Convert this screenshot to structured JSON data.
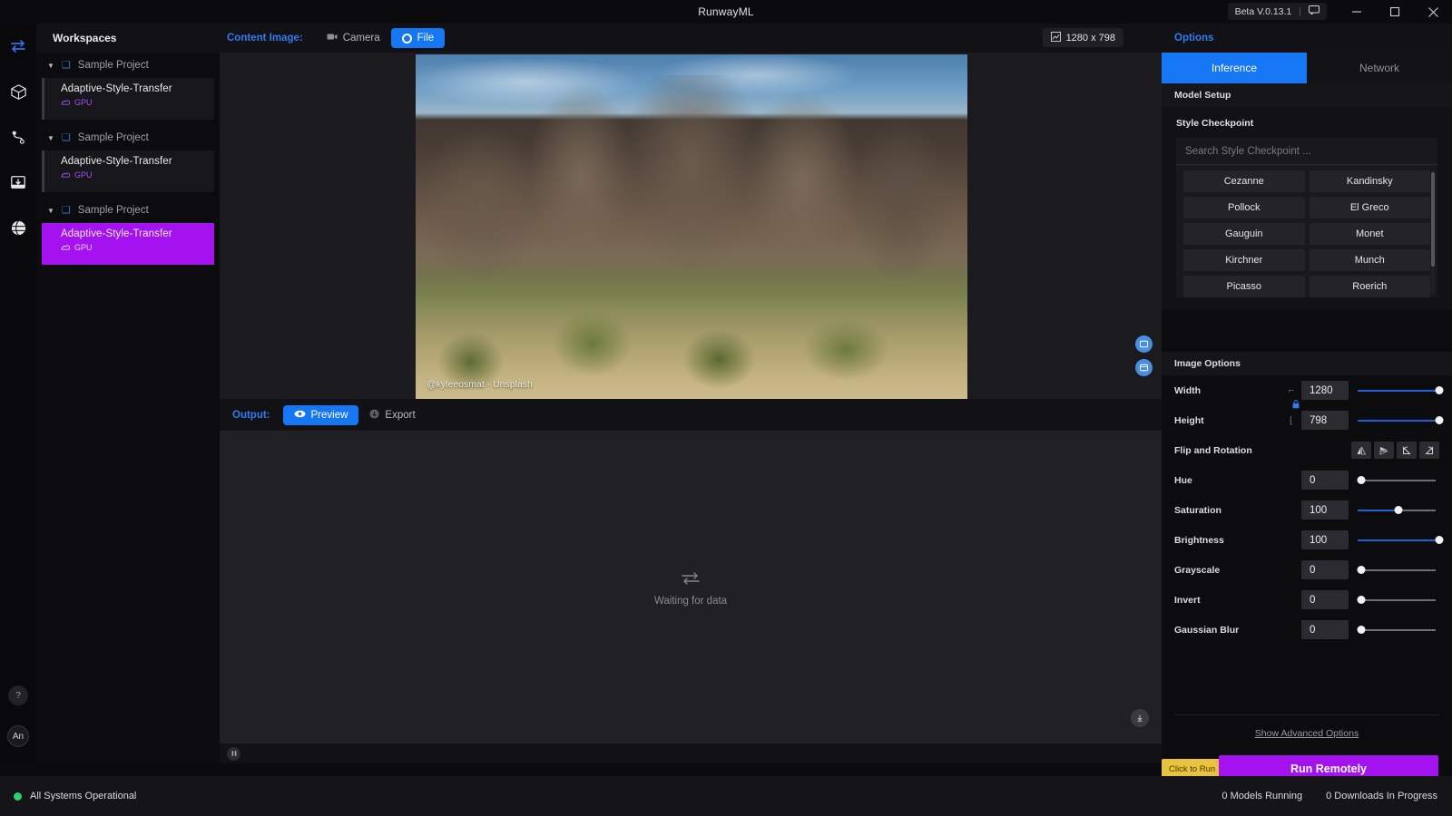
{
  "titlebar": {
    "app_title": "RunwayML",
    "beta_version": "Beta V.0.13.1",
    "separator": "|",
    "chat_icon": "chat-bubble-icon",
    "minimize": "minimize-icon",
    "maximize": "maximize-icon",
    "close": "close-icon"
  },
  "rail": {
    "items": [
      {
        "icon": "transfer-arrows-icon",
        "name": "models-transfer"
      },
      {
        "icon": "cube-icon",
        "name": "models"
      },
      {
        "icon": "workflow-nodes-icon",
        "name": "workflows"
      },
      {
        "icon": "inbox-download-icon",
        "name": "downloads"
      },
      {
        "icon": "globe-icon",
        "name": "community"
      }
    ],
    "help_label": "?",
    "avatar_label": "An"
  },
  "sidebar": {
    "header": "Workspaces",
    "groups": [
      {
        "project": "Sample Project",
        "nodes": [
          {
            "title": "Adaptive-Style-Transfer",
            "sub": "GPU",
            "active": false
          }
        ]
      },
      {
        "project": "Sample Project",
        "nodes": [
          {
            "title": "Adaptive-Style-Transfer",
            "sub": "GPU",
            "active": false
          }
        ]
      },
      {
        "project": "Sample Project",
        "nodes": [
          {
            "title": "Adaptive-Style-Transfer",
            "sub": "GPU",
            "active": true
          }
        ]
      }
    ]
  },
  "content": {
    "label": "Content Image:",
    "source_camera": "Camera",
    "source_file": "File",
    "active_source": "File",
    "dimensions": "1280 x 798",
    "dimensions_icon": "image-size-icon",
    "watermark": "@kyleeosmat - Unsplash",
    "float_buttons": [
      {
        "icon": "image-add-icon",
        "name": "add-image-button"
      },
      {
        "icon": "image-swap-icon",
        "name": "swap-image-button"
      }
    ]
  },
  "output": {
    "label": "Output:",
    "tab_preview": "Preview",
    "tab_export": "Export",
    "active_tab": "Preview",
    "waiting_icon": "transfer-arrows-icon",
    "waiting_text": "Waiting for data",
    "download_icon": "download-icon",
    "pause_icon": "pause-icon"
  },
  "options": {
    "header": "Options",
    "tabs": [
      {
        "label": "Inference",
        "active": true
      },
      {
        "label": "Network",
        "active": false
      }
    ],
    "model_setup_header": "Model Setup",
    "style_checkpoint_label": "Style Checkpoint",
    "search_placeholder": "Search Style Checkpoint ...",
    "search_value": "",
    "checkpoints": [
      "Cezanne",
      "Kandinsky",
      "Pollock",
      "El Greco",
      "Gauguin",
      "Monet",
      "Kirchner",
      "Munch",
      "Picasso",
      "Roerich"
    ],
    "image_options_header": "Image Options",
    "lock_icon": "lock-icon",
    "rows": [
      {
        "name": "Width",
        "value": "1280",
        "fill_pct": 100,
        "knob_pct": 100,
        "type": "slider"
      },
      {
        "name": "Height",
        "value": "798",
        "fill_pct": 100,
        "knob_pct": 100,
        "type": "slider"
      },
      {
        "name": "Flip and Rotation",
        "type": "buttons",
        "buttons": [
          {
            "icon": "flip-horizontal-icon",
            "name": "flip-horizontal-button"
          },
          {
            "icon": "flip-vertical-icon",
            "name": "flip-vertical-button"
          },
          {
            "icon": "rotate-left-icon",
            "name": "rotate-left-button"
          },
          {
            "icon": "rotate-right-icon",
            "name": "rotate-right-button"
          }
        ]
      },
      {
        "name": "Hue",
        "value": "0",
        "fill_pct": 0,
        "knob_pct": 4,
        "type": "slider"
      },
      {
        "name": "Saturation",
        "value": "100",
        "fill_pct": 50,
        "knob_pct": 50,
        "type": "slider"
      },
      {
        "name": "Brightness",
        "value": "100",
        "fill_pct": 100,
        "knob_pct": 100,
        "type": "slider"
      },
      {
        "name": "Grayscale",
        "value": "0",
        "fill_pct": 0,
        "knob_pct": 4,
        "type": "slider"
      },
      {
        "name": "Invert",
        "value": "0",
        "fill_pct": 0,
        "knob_pct": 4,
        "type": "slider"
      },
      {
        "name": "Gaussian Blur",
        "value": "0",
        "fill_pct": 0,
        "knob_pct": 4,
        "type": "slider"
      }
    ],
    "advanced_link": "Show Advanced Options",
    "run_tooltip": "Click to Run",
    "run_button": "Run Remotely"
  },
  "statusbar": {
    "system_status": "All Systems Operational",
    "models_running": "0 Models Running",
    "downloads": "0 Downloads In Progress",
    "status_color": "#2fd06b"
  }
}
